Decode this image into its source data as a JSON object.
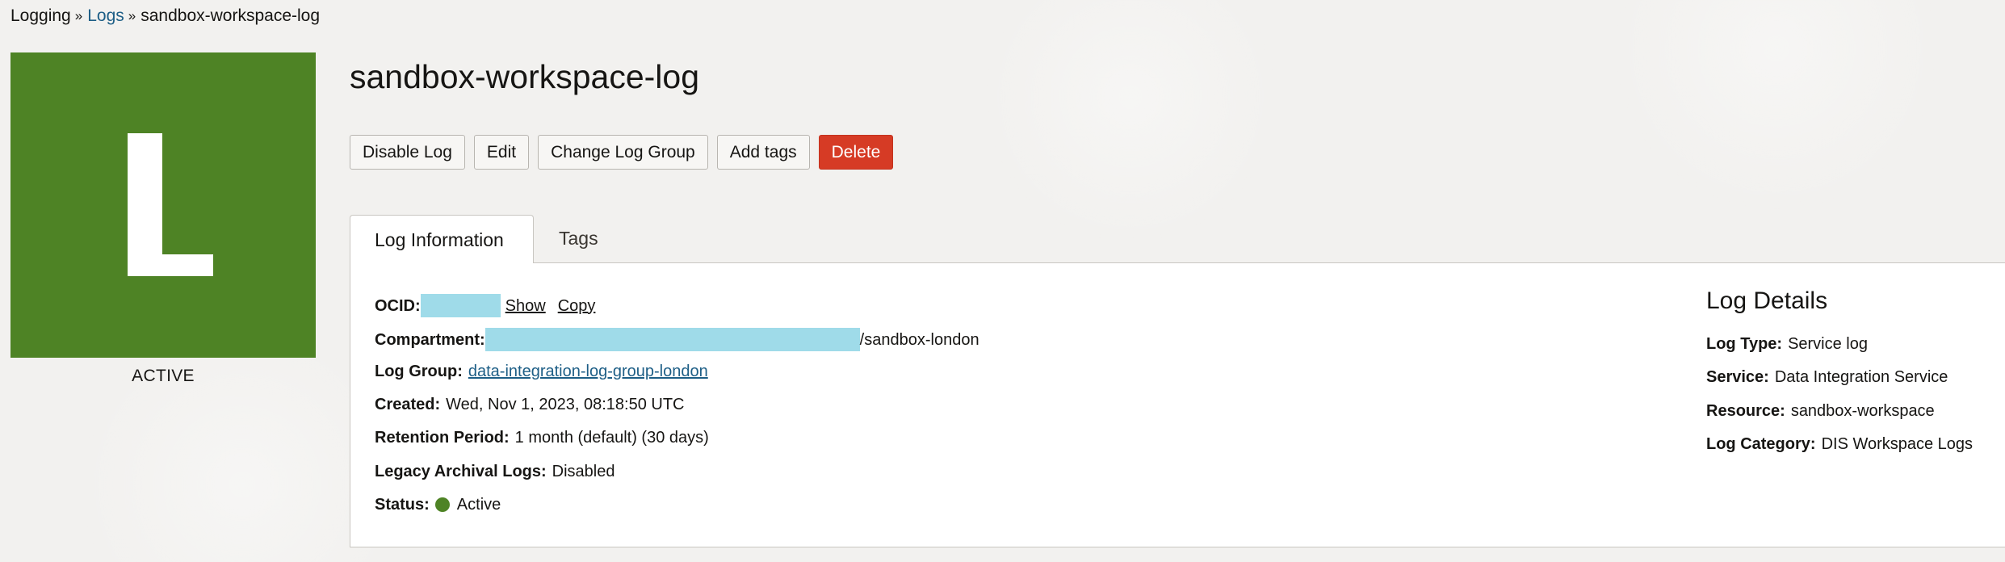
{
  "breadcrumb": {
    "items": [
      "Logging",
      "Logs",
      "sandbox-workspace-log"
    ],
    "separator": "»"
  },
  "badge": {
    "letter": "L",
    "status": "ACTIVE",
    "color": "#4e8325"
  },
  "page_title": "sandbox-workspace-log",
  "actions": {
    "disable": "Disable Log",
    "edit": "Edit",
    "change_group": "Change Log Group",
    "add_tags": "Add tags",
    "delete": "Delete"
  },
  "tabs": {
    "active": "Log Information",
    "other": "Tags"
  },
  "info": {
    "ocid_label": "OCID:",
    "ocid_show": "Show",
    "ocid_copy": "Copy",
    "compartment_label": "Compartment:",
    "compartment_suffix": "/sandbox-london",
    "log_group_label": "Log Group:",
    "log_group_value": "data-integration-log-group-london",
    "created_label": "Created:",
    "created_value": "Wed, Nov 1, 2023, 08:18:50 UTC",
    "retention_label": "Retention Period:",
    "retention_value": "1 month (default) (30 days)",
    "legacy_label": "Legacy Archival Logs:",
    "legacy_value": "Disabled",
    "status_label": "Status:",
    "status_value": "Active",
    "status_color": "#4e8325"
  },
  "details": {
    "title": "Log Details",
    "log_type_label": "Log Type:",
    "log_type_value": "Service log",
    "service_label": "Service:",
    "service_value": "Data Integration Service",
    "resource_label": "Resource:",
    "resource_value": "sandbox-workspace",
    "category_label": "Log Category:",
    "category_value": "DIS Workspace Logs"
  },
  "colors": {
    "link": "#1d5e86",
    "danger": "#d63b25",
    "redaction": "#9fdbe9"
  }
}
